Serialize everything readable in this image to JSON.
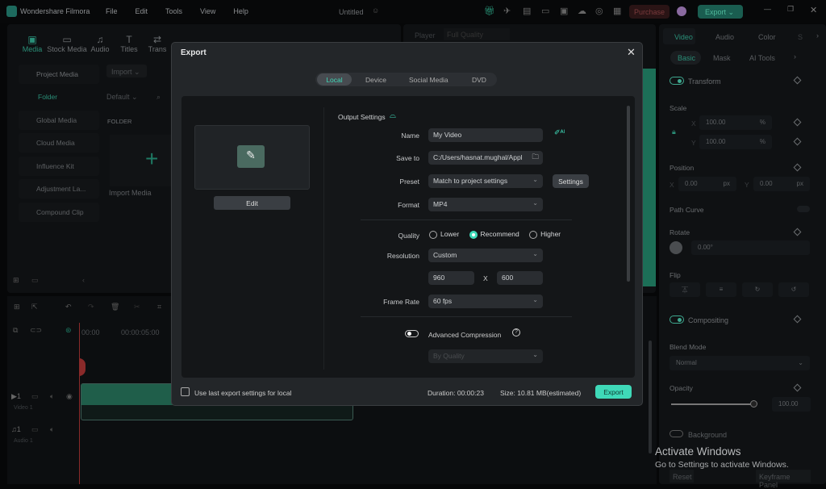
{
  "app": {
    "name": "Wondershare Filmora",
    "menu": [
      "File",
      "Edit",
      "Tools",
      "View",
      "Help"
    ],
    "project_title": "Untitled",
    "purchase_label": "Purchase",
    "export_label": "Export"
  },
  "toolbar": {
    "tabs": [
      {
        "label": "Media",
        "active": true
      },
      {
        "label": "Stock Media"
      },
      {
        "label": "Audio"
      },
      {
        "label": "Titles"
      },
      {
        "label": "Trans"
      }
    ]
  },
  "sidebar": {
    "items": [
      "Project Media",
      "Folder",
      "Global Media",
      "Cloud Media",
      "Influence Kit",
      "Adjustment La...",
      "Compound Clip"
    ]
  },
  "media": {
    "import_label": "Import",
    "sort_label": "Default",
    "folder_header": "FOLDER",
    "import_media_label": "Import Media"
  },
  "player": {
    "label": "Player",
    "quality": "Full Quality"
  },
  "timeline": {
    "time_marks": [
      "00:00",
      "00:00:05:00"
    ],
    "tracks": [
      {
        "label": "Video 1",
        "num": "1"
      },
      {
        "label": "Audio 1",
        "num": "1"
      }
    ]
  },
  "right_panel": {
    "tabs": [
      "Video",
      "Audio",
      "Color",
      "S"
    ],
    "subtabs": [
      "Basic",
      "Mask",
      "AI Tools"
    ],
    "transform": "Transform",
    "scale": "Scale",
    "scale_x": "100.00",
    "scale_y": "100.00",
    "pct": "%",
    "x": "X",
    "y": "Y",
    "position": "Position",
    "pos_x": "0.00",
    "pos_y": "0.00",
    "px": "px",
    "path_curve": "Path Curve",
    "rotate": "Rotate",
    "rotate_value": "0.00°",
    "flip": "Flip",
    "compositing": "Compositing",
    "blend_mode": "Blend Mode",
    "blend_value": "Normal",
    "opacity": "Opacity",
    "opacity_value": "100.00",
    "opacity_level": 100,
    "background": "Background",
    "reset": "Reset",
    "keyframe_panel": "Keyframe Panel"
  },
  "watermark": {
    "line1": "Activate Windows",
    "line2": "Go to Settings to activate Windows."
  },
  "export_dialog": {
    "title": "Export",
    "tabs": [
      {
        "label": "Local",
        "active": true
      },
      {
        "label": "Device"
      },
      {
        "label": "Social Media"
      },
      {
        "label": "DVD"
      }
    ],
    "edit_label": "Edit",
    "output_settings": "Output Settings",
    "name_label": "Name",
    "name_value": "My Video",
    "save_to_label": "Save to",
    "save_to_value": "C:/Users/hasnat.mughal/Appl",
    "preset_label": "Preset",
    "preset_value": "Match to project settings",
    "settings_label": "Settings",
    "format_label": "Format",
    "format_value": "MP4",
    "quality_label": "Quality",
    "quality_options": [
      "Lower",
      "Recommend",
      "Higher"
    ],
    "quality_selected": "Recommend",
    "resolution_label": "Resolution",
    "resolution_value": "Custom",
    "width": "960",
    "x_sep": "X",
    "height": "600",
    "frame_rate_label": "Frame Rate",
    "frame_rate_value": "60 fps",
    "advanced_compression": "Advanced Compression",
    "advanced_enabled": false,
    "compression_mode": "By Quality",
    "use_last_label": "Use last export settings for local",
    "use_last_checked": false,
    "duration": "Duration: 00:00:23",
    "size": "Size: 10.81 MB(estimated)",
    "export_label": "Export",
    "accent": "#3fd9b8"
  }
}
